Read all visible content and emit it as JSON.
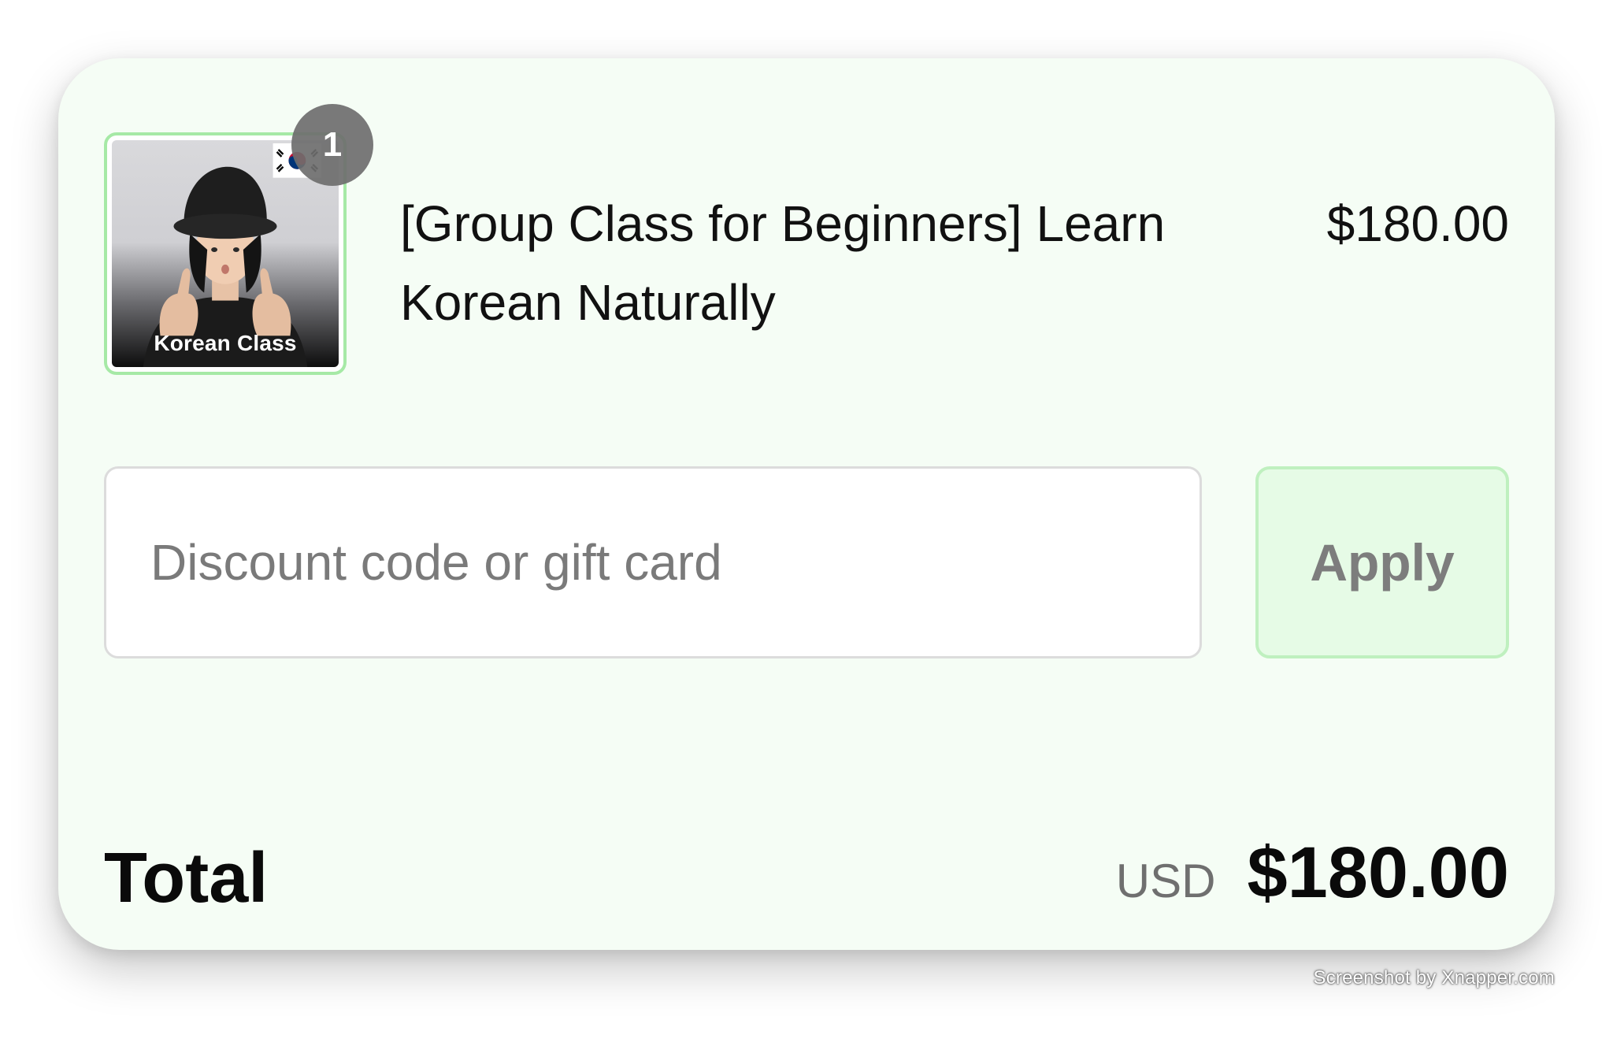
{
  "line_item": {
    "thumbnail_caption": "Korean Class",
    "quantity": "1",
    "name": "[Group Class for Beginners] Learn Korean Naturally",
    "price": "$180.00"
  },
  "discount": {
    "placeholder": "Discount code or gift card",
    "value": "",
    "apply_label": "Apply"
  },
  "total": {
    "label": "Total",
    "currency": "USD",
    "amount": "$180.00"
  },
  "watermark": "Screenshot by Xnapper.com",
  "colors": {
    "card_background": "#f5fdf5",
    "thumbnail_border": "#a6e9a6",
    "apply_background": "#e6fbe6",
    "badge": "#6e6e6e"
  },
  "icons": {
    "flag": "south-korea-flag-icon"
  }
}
